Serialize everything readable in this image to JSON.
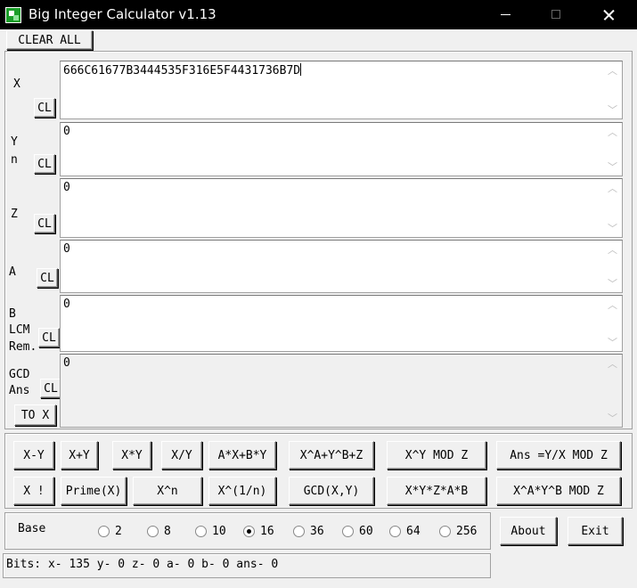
{
  "window": {
    "title": "Big Integer Calculator v1.13",
    "icons": {
      "app": "app-icon",
      "minimize": "minimize-icon",
      "maximize": "maximize-icon",
      "close": "close-icon"
    }
  },
  "toolbar": {
    "clear_all_label": "CLEAR ALL"
  },
  "fields": {
    "x": {
      "label": "X",
      "value": "666C61677B3444535F316E5F4431736B7D",
      "clear_label": "CL"
    },
    "y": {
      "label1": "Y",
      "label2": "n",
      "value": "0",
      "clear_label": "CL"
    },
    "z": {
      "label": "Z",
      "value": "0",
      "clear_label": "CL"
    },
    "a": {
      "label": "A",
      "value": "0",
      "clear_label": "CL"
    },
    "b": {
      "label1": "B",
      "label2": "LCM",
      "label3": "Rem.",
      "value": "0",
      "clear_label": "CL"
    },
    "ans": {
      "label1": "GCD",
      "label2": "Ans",
      "value": "0",
      "clear_label": "CL",
      "to_x_label": "TO X"
    }
  },
  "operations": {
    "row1": [
      "X-Y",
      "X+Y",
      "X*Y",
      "X/Y",
      "A*X+B*Y",
      "X^A+Y^B+Z",
      "X^Y MOD Z",
      "Ans =Y/X MOD Z"
    ],
    "row2": [
      "X !",
      "Prime(X)",
      "X^n",
      "X^(1/n)",
      "GCD(X,Y)",
      "X*Y*Z*A*B",
      "X^A*Y^B MOD Z"
    ]
  },
  "base": {
    "label": "Base",
    "options": [
      "2",
      "8",
      "10",
      "16",
      "36",
      "60",
      "64",
      "256"
    ],
    "selected": "16"
  },
  "buttons": {
    "about": "About",
    "exit": "Exit"
  },
  "status": {
    "bits": "Bits: x- 135 y- 0 z- 0 a- 0 b- 0 ans- 0"
  }
}
